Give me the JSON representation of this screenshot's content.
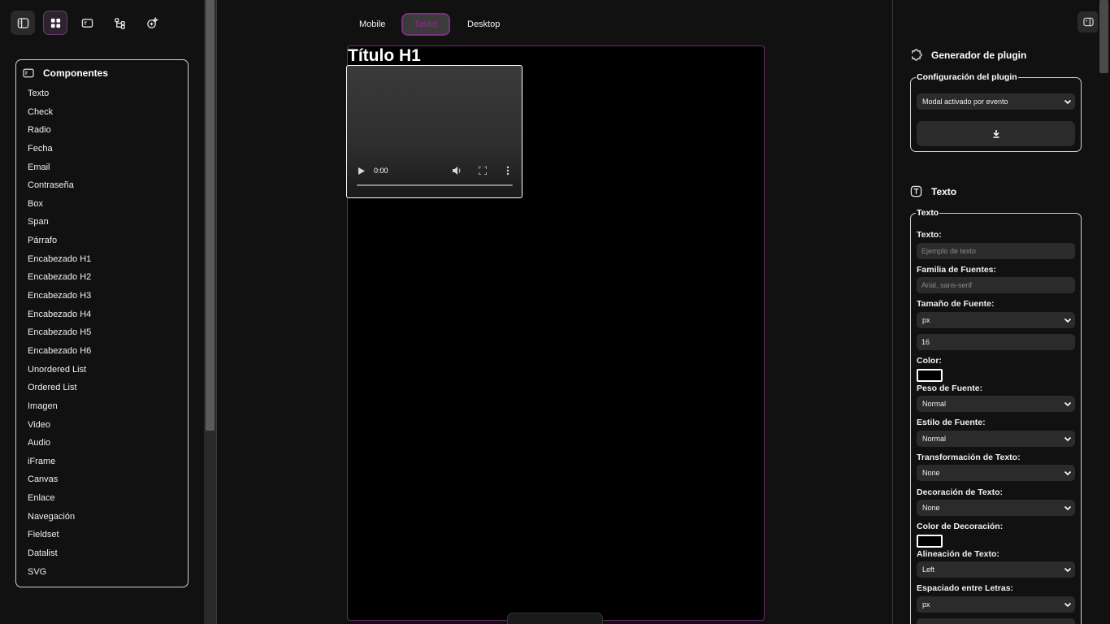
{
  "left_toolbar": {
    "buttons": [
      {
        "icon": "sidebar-toggle-icon",
        "state": "idle"
      },
      {
        "icon": "grid-icon",
        "state": "active"
      },
      {
        "icon": "component-icon",
        "state": "idle"
      },
      {
        "icon": "tree-icon",
        "state": "idle"
      },
      {
        "icon": "magic-icon",
        "state": "idle"
      }
    ]
  },
  "components": {
    "title": "Componentes",
    "items": [
      "Texto",
      "Check",
      "Radio",
      "Fecha",
      "Email",
      "Contraseña",
      "Box",
      "Span",
      "Párrafo",
      "Encabezado H1",
      "Encabezado H2",
      "Encabezado H3",
      "Encabezado H4",
      "Encabezado H5",
      "Encabezado H6",
      "Unordered List",
      "Ordered List",
      "Imagen",
      "Video",
      "Audio",
      "iFrame",
      "Canvas",
      "Enlace",
      "Navegación",
      "Fieldset",
      "Datalist",
      "SVG"
    ]
  },
  "viewport_tabs": {
    "mobile": "Mobile",
    "tablet": "Tablet",
    "desktop": "Desktop",
    "active": "tablet"
  },
  "canvas": {
    "title": "Título H1",
    "video_time": "0:00"
  },
  "plugin": {
    "title": "Generador de plugin",
    "legend": "Configuración del plugin",
    "mode": "Modal activado por evento"
  },
  "text_section": {
    "title": "Texto",
    "legend": "Texto",
    "fields": {
      "text_label": "Texto:",
      "text_placeholder": "Ejemplo de texto",
      "font_family_label": "Familia de Fuentes:",
      "font_family_placeholder": "Arial, sans-serif",
      "font_size_label": "Tamaño de Fuente:",
      "font_size_unit": "px",
      "font_size_value": "16",
      "color_label": "Color:",
      "font_weight_label": "Peso de Fuente:",
      "font_weight": "Normal",
      "font_style_label": "Estilo de Fuente:",
      "font_style": "Normal",
      "text_transform_label": "Transformación de Texto:",
      "text_transform": "None",
      "text_decoration_label": "Decoración de Texto:",
      "text_decoration": "None",
      "decoration_color_label": "Color de Decoración:",
      "text_align_label": "Alineación de Texto:",
      "text_align": "Left",
      "letter_spacing_label": "Espaciado entre Letras:",
      "letter_spacing_unit": "px"
    }
  },
  "colors": {
    "accent": "#7a2f80",
    "background": "#111111",
    "frame_border": "#6b2a6e"
  }
}
